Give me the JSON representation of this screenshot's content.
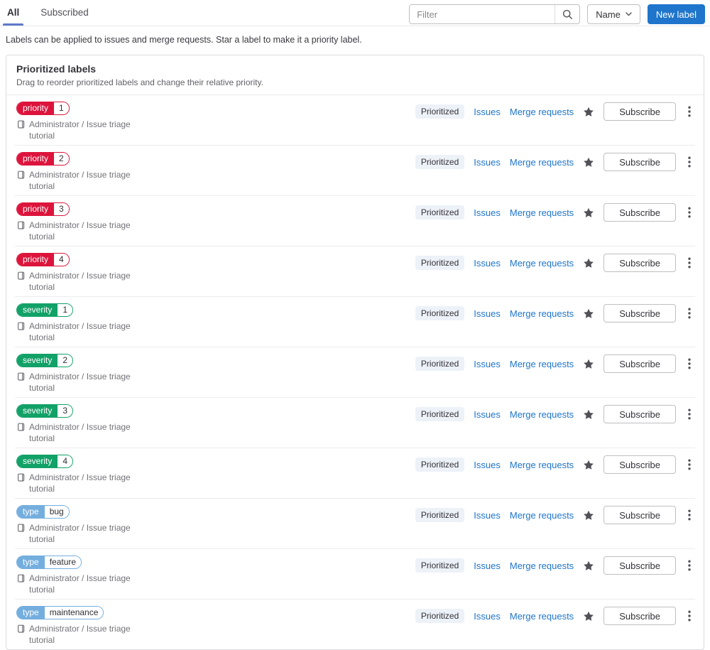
{
  "tabs": {
    "all": "All",
    "subscribed": "Subscribed"
  },
  "filter": {
    "placeholder": "Filter"
  },
  "sort": {
    "label": "Name"
  },
  "new_label_button": "New label",
  "description": "Labels can be applied to issues and merge requests. Star a label to make it a priority label.",
  "card": {
    "title": "Prioritized labels",
    "subtitle": "Drag to reorder prioritized labels and change their relative priority."
  },
  "row_actions": {
    "prioritized_badge": "Prioritized",
    "issues_link": "Issues",
    "merge_requests_link": "Merge requests",
    "subscribe_button": "Subscribe"
  },
  "colors": {
    "accent": "#1f75cb",
    "tab_indicator": "#5e79c9",
    "priority": "#dc143c",
    "severity": "#12a167",
    "type": "#74aede",
    "prioritized_badge_bg": "#edf1f8"
  },
  "labels": [
    {
      "scope": "priority",
      "value": "1",
      "color_key": "priority",
      "project": "Administrator / Issue triage tutorial"
    },
    {
      "scope": "priority",
      "value": "2",
      "color_key": "priority",
      "project": "Administrator / Issue triage tutorial"
    },
    {
      "scope": "priority",
      "value": "3",
      "color_key": "priority",
      "project": "Administrator / Issue triage tutorial"
    },
    {
      "scope": "priority",
      "value": "4",
      "color_key": "priority",
      "project": "Administrator / Issue triage tutorial"
    },
    {
      "scope": "severity",
      "value": "1",
      "color_key": "severity",
      "project": "Administrator / Issue triage tutorial"
    },
    {
      "scope": "severity",
      "value": "2",
      "color_key": "severity",
      "project": "Administrator / Issue triage tutorial"
    },
    {
      "scope": "severity",
      "value": "3",
      "color_key": "severity",
      "project": "Administrator / Issue triage tutorial"
    },
    {
      "scope": "severity",
      "value": "4",
      "color_key": "severity",
      "project": "Administrator / Issue triage tutorial"
    },
    {
      "scope": "type",
      "value": "bug",
      "color_key": "type",
      "project": "Administrator / Issue triage tutorial"
    },
    {
      "scope": "type",
      "value": "feature",
      "color_key": "type",
      "project": "Administrator / Issue triage tutorial"
    },
    {
      "scope": "type",
      "value": "maintenance",
      "color_key": "type",
      "project": "Administrator / Issue triage tutorial"
    }
  ]
}
